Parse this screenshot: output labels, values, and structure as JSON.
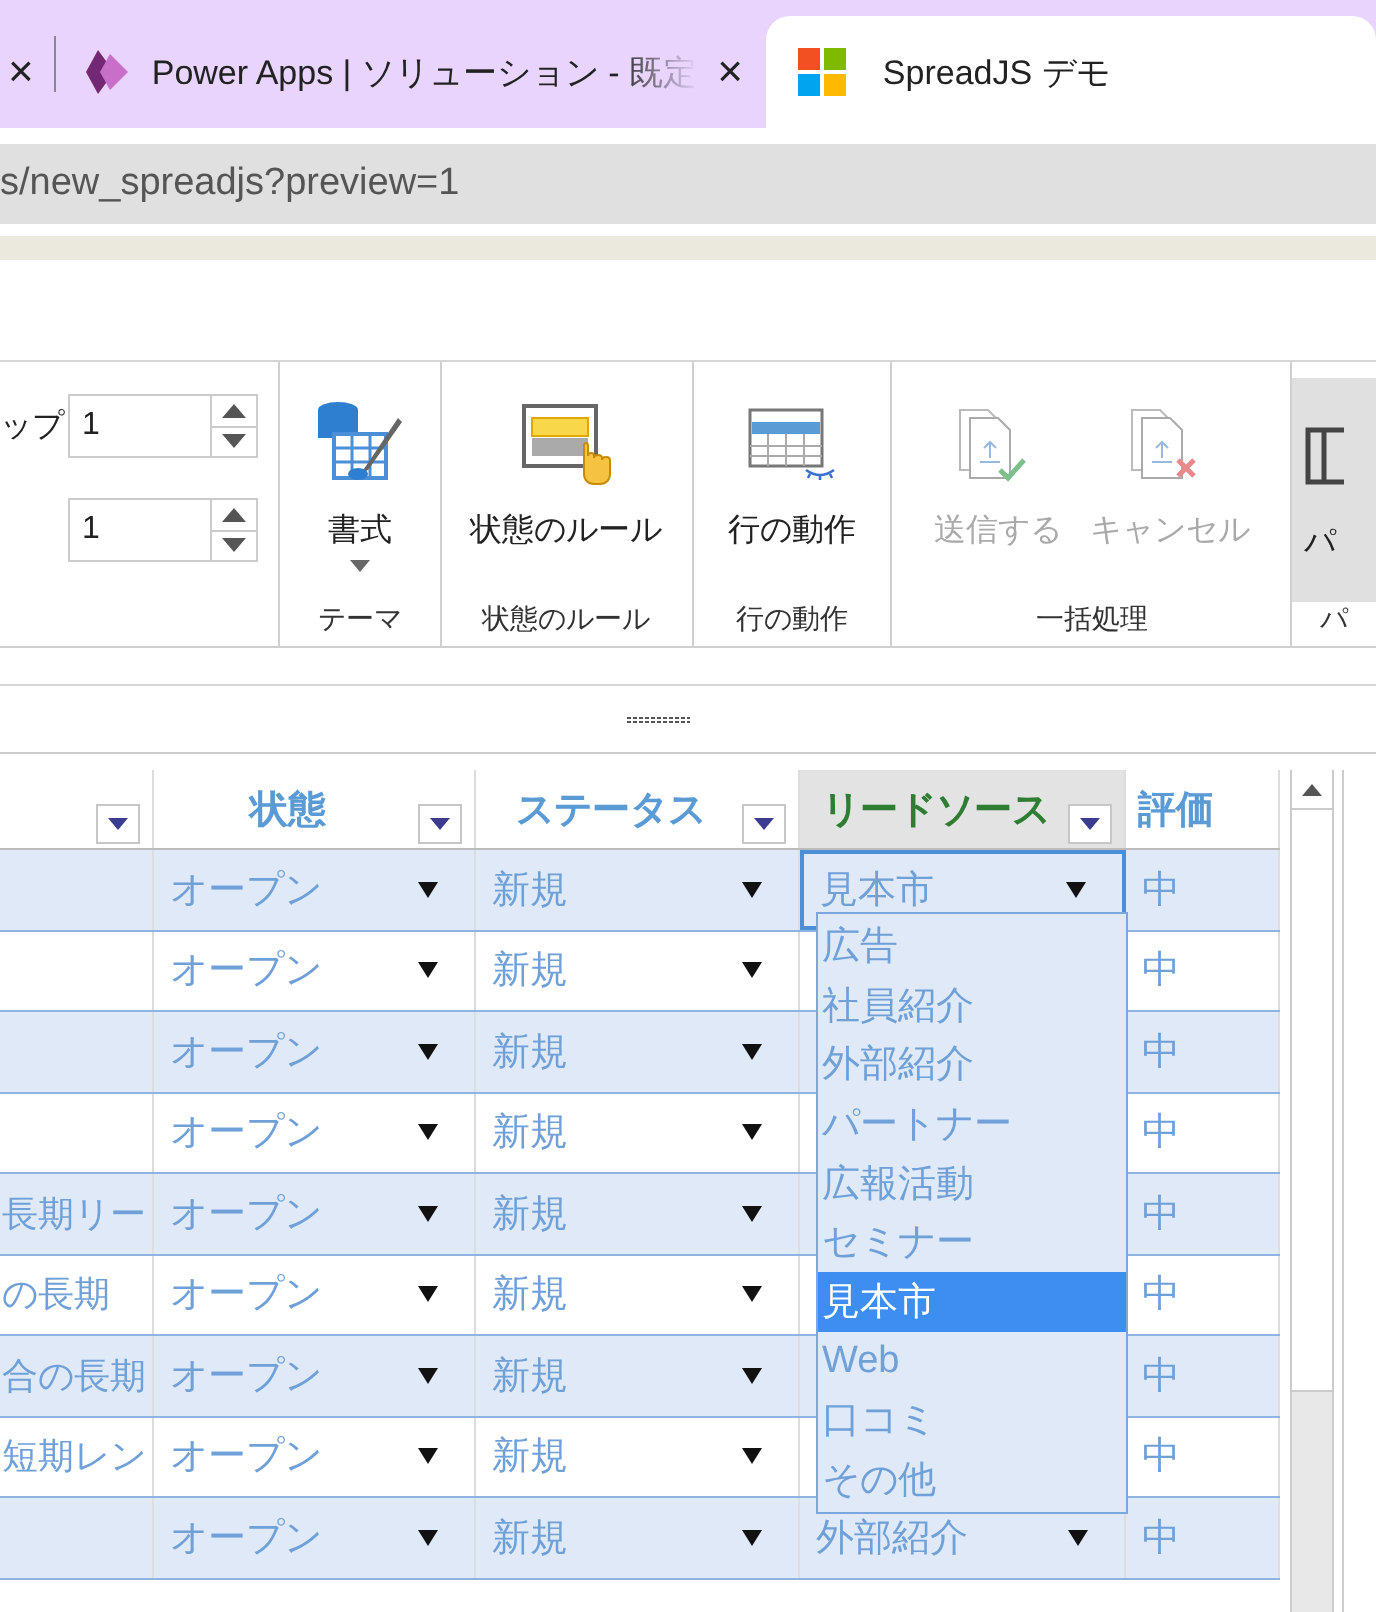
{
  "browser": {
    "tabs": [
      {
        "close": "×",
        "selected": false
      },
      {
        "title": "Power Apps | ソリューション - 既定",
        "close": "×",
        "selected": false
      },
      {
        "title": "SpreadJS デモ",
        "selected": true
      }
    ],
    "address": "s/new_spreadjs?preview=1"
  },
  "ribbon": {
    "spinners": [
      {
        "label": "ップ",
        "value": "1"
      },
      {
        "value": "1"
      }
    ],
    "groups": [
      {
        "label": "テーマ",
        "buttons": [
          {
            "label": "書式",
            "dropdown": true,
            "disabled": false
          }
        ]
      },
      {
        "label": "状態のルール",
        "buttons": [
          {
            "label": "状態のルール",
            "dropdown": false,
            "disabled": false
          }
        ]
      },
      {
        "label": "行の動作",
        "buttons": [
          {
            "label": "行の動作",
            "dropdown": false,
            "disabled": false
          }
        ]
      },
      {
        "label": "一括処理",
        "buttons": [
          {
            "label": "送信する",
            "dropdown": false,
            "disabled": true
          },
          {
            "label": "キャンセル",
            "dropdown": false,
            "disabled": true
          }
        ]
      },
      {
        "label": "パ",
        "buttons": [
          {
            "label": "パ",
            "dropdown": false,
            "disabled": false
          }
        ]
      }
    ]
  },
  "grid": {
    "columns": [
      {
        "selected": false
      },
      {
        "label": "状態",
        "selected": false
      },
      {
        "label": "ステータス",
        "selected": false
      },
      {
        "label": "リードソース",
        "selected": true
      },
      {
        "label": "評価",
        "selected": false
      }
    ],
    "rows": [
      {
        "cells": [
          "",
          "オープン",
          "新規",
          "見本市",
          "中"
        ],
        "editing": true
      },
      {
        "cells": [
          "",
          "オープン",
          "新規",
          "",
          "中"
        ],
        "editing": false
      },
      {
        "cells": [
          "",
          "オープン",
          "新規",
          "",
          "中"
        ],
        "editing": false
      },
      {
        "cells": [
          "",
          "オープン",
          "新規",
          "",
          "中"
        ],
        "editing": false
      },
      {
        "cells": [
          "長期リー",
          "オープン",
          "新規",
          "",
          "中"
        ],
        "editing": false
      },
      {
        "cells": [
          "の長期",
          "オープン",
          "新規",
          "",
          "中"
        ],
        "editing": false
      },
      {
        "cells": [
          "合の長期",
          "オープン",
          "新規",
          "",
          "中"
        ],
        "editing": false
      },
      {
        "cells": [
          "短期レン",
          "オープン",
          "新規",
          "",
          "中"
        ],
        "editing": false
      },
      {
        "cells": [
          "",
          "オープン",
          "新規",
          "外部紹介",
          "中"
        ],
        "editing": false
      }
    ],
    "dropdown": {
      "items": [
        {
          "label": "広告",
          "selected": false
        },
        {
          "label": "社員紹介",
          "selected": false
        },
        {
          "label": "外部紹介",
          "selected": false
        },
        {
          "label": "パートナー",
          "selected": false
        },
        {
          "label": "広報活動",
          "selected": false
        },
        {
          "label": "セミナー",
          "selected": false
        },
        {
          "label": "見本市",
          "selected": true
        },
        {
          "label": "Web",
          "selected": false
        },
        {
          "label": "口コミ",
          "selected": false
        },
        {
          "label": "その他",
          "selected": false
        }
      ]
    }
  }
}
